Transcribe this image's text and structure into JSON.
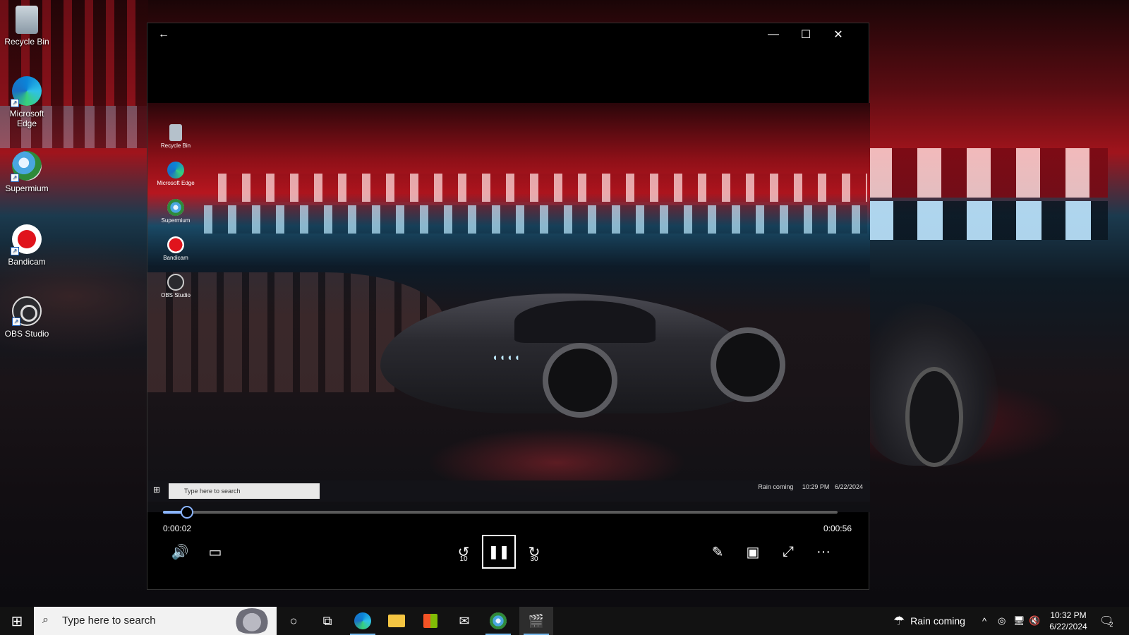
{
  "desktop": {
    "icons": [
      {
        "label": "Recycle Bin",
        "icon": "recycle-bin-icon"
      },
      {
        "label": "Microsoft Edge",
        "icon": "edge-icon"
      },
      {
        "label": "Supermium",
        "icon": "supermium-icon"
      },
      {
        "label": "Bandicam",
        "icon": "bandicam-icon"
      },
      {
        "label": "OBS Studio",
        "icon": "obs-studio-icon"
      }
    ]
  },
  "player": {
    "titlebar": {
      "back": "←",
      "minimize": "—",
      "maximize": "☐",
      "close": "✕"
    },
    "video": {
      "desktop_icons": [
        "Recycle Bin",
        "Microsoft Edge",
        "Supermium",
        "Bandicam",
        "OBS Studio"
      ],
      "taskbar_search_placeholder": "Type here to search",
      "tray_weather": "Rain coming",
      "tray_time": "10:29 PM",
      "tray_date": "6/22/2024"
    },
    "progress": {
      "position": 0.036,
      "elapsed": "0:00:02",
      "total": "0:00:56"
    },
    "controls": {
      "volume": "🔊",
      "subtitles": "▭",
      "skip_back": "↺",
      "skip_back_seconds": "10",
      "play_pause": "❚❚",
      "skip_forward": "↻",
      "skip_forward_seconds": "30",
      "edit": "✎",
      "mini_view": "▣",
      "fullscreen": "⤢",
      "more": "···"
    },
    "accent_color": "#8ab4ff"
  },
  "taskbar": {
    "start": "⊞",
    "search_icon": "⌕",
    "search_placeholder": "Type here to search",
    "cortana": "○",
    "task_view": "⧉",
    "pinned": [
      {
        "name": "edge",
        "glyph": "e"
      },
      {
        "name": "file-explorer",
        "glyph": "▬"
      },
      {
        "name": "microsoft-store",
        "glyph": "⊞"
      },
      {
        "name": "mail",
        "glyph": "✉"
      },
      {
        "name": "supermium",
        "glyph": "◉"
      },
      {
        "name": "movies-tv",
        "glyph": "🎬"
      }
    ],
    "tray": {
      "weather_icon": "☂",
      "weather": "Rain coming",
      "chevron": "^",
      "time": "10:32 PM",
      "date": "6/22/2024",
      "notifications": "2"
    }
  }
}
